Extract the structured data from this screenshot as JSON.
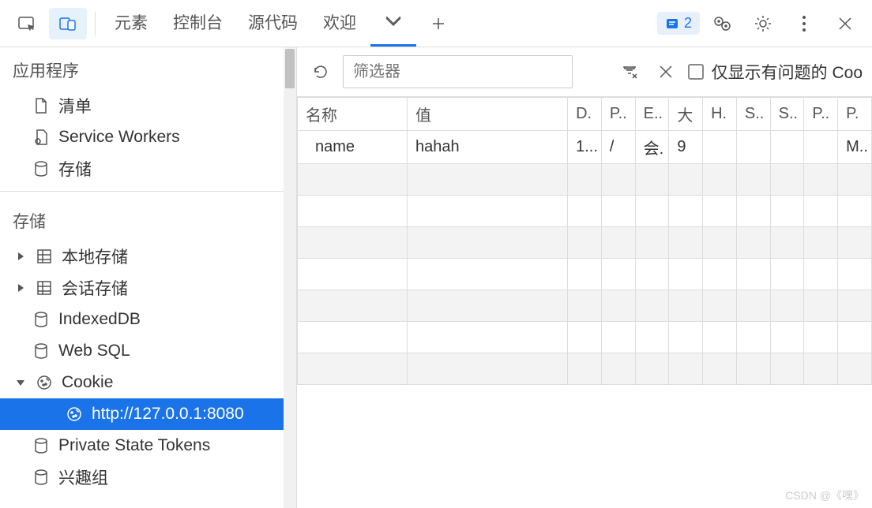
{
  "topbar": {
    "tabs": [
      "元素",
      "控制台",
      "源代码",
      "欢迎"
    ],
    "issues_count": "2"
  },
  "sidebar": {
    "section_app": "应用程序",
    "app_items": {
      "manifest": "清单",
      "service_workers": "Service Workers",
      "storage_overview": "存储"
    },
    "section_storage": "存储",
    "storage_items": {
      "local_storage": "本地存储",
      "session_storage": "会话存储",
      "indexeddb": "IndexedDB",
      "websql": "Web SQL",
      "cookie": "Cookie",
      "cookie_origin": "http://127.0.0.1:8080",
      "private_state_tokens": "Private State Tokens",
      "interest_groups": "兴趣组"
    }
  },
  "filter": {
    "placeholder": "筛选器",
    "only_issues_label": "仅显示有问题的 Coo"
  },
  "table": {
    "headers": {
      "name": "名称",
      "value": "值",
      "d": "D.",
      "p": "P..",
      "e": "E..",
      "size": "大",
      "h": "H.",
      "s": "S..",
      "s2": "S..",
      "p2": "P..",
      "p3": "P."
    },
    "row": {
      "name": "name",
      "value": "hahah",
      "d": "1...",
      "p": "/",
      "e": "会.",
      "size": "9",
      "h": "",
      "s": "",
      "s2": "",
      "p2": "",
      "p3": "M.."
    }
  },
  "watermark": "CSDN @《嘿》"
}
